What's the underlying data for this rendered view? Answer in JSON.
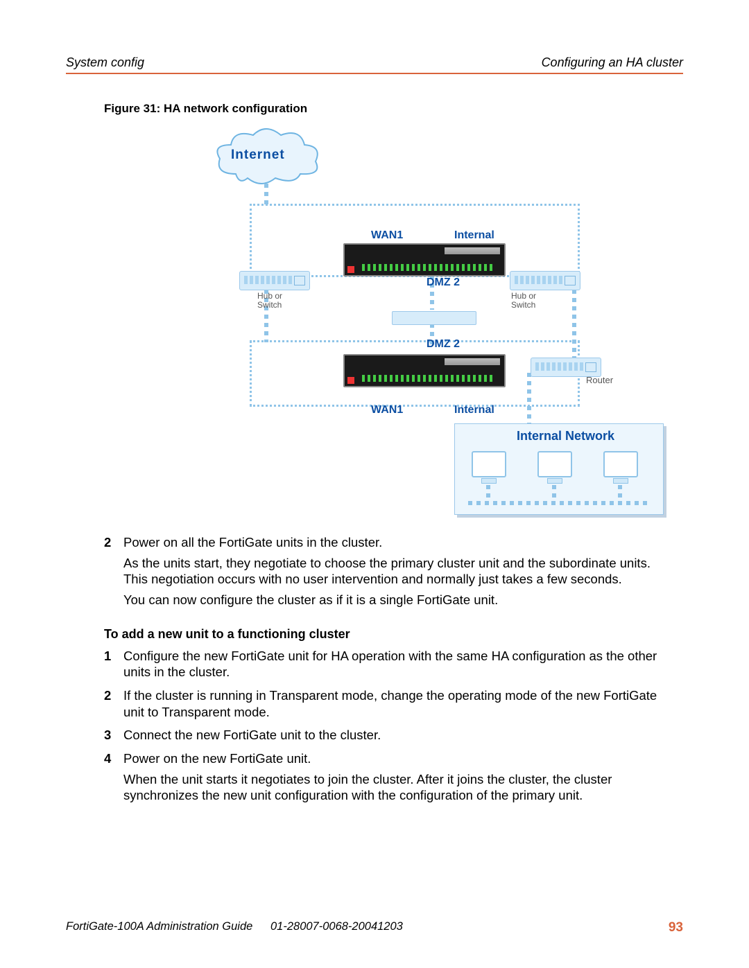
{
  "header": {
    "left": "System config",
    "right": "Configuring an HA cluster"
  },
  "figure": {
    "caption": "Figure 31: HA network configuration",
    "internet": "Internet",
    "wan1_top": "WAN1",
    "wan1_bot": "WAN1",
    "internal_top": "Internal",
    "internal_bot": "Internal",
    "dmz_upper": "DMZ 2",
    "dmz_lower": "DMZ 2",
    "hublabel_left": "Hub or\nSwitch",
    "hublabel_right": "Hub or\nSwitch",
    "router": "Router",
    "intnet": "Internal Network"
  },
  "step_before": {
    "num": "2",
    "p1": "Power on all the FortiGate units in the cluster.",
    "p2": "As the units start, they negotiate to choose the primary cluster unit and the subordinate units. This negotiation occurs with no user intervention and normally just takes a few seconds.",
    "p3": "You can now configure the cluster as if it is a single FortiGate unit."
  },
  "subhead": "To add a new unit to a functioning cluster",
  "steps": [
    {
      "num": "1",
      "text1": "Configure the new FortiGate unit for HA operation with the same HA configuration as the other units in the cluster."
    },
    {
      "num": "2",
      "text1": "If the cluster is running in Transparent mode, change the operating mode of the new FortiGate unit to Transparent mode."
    },
    {
      "num": "3",
      "text1": "Connect the new FortiGate unit to the cluster."
    },
    {
      "num": "4",
      "text1": "Power on the new FortiGate unit.",
      "text2": "When the unit starts it negotiates to join the cluster. After it joins the cluster, the cluster synchronizes the new unit configuration with the configuration of the primary unit."
    }
  ],
  "footer": {
    "guide": "FortiGate-100A Administration Guide",
    "docnum": "01-28007-0068-20041203",
    "page": "93"
  }
}
